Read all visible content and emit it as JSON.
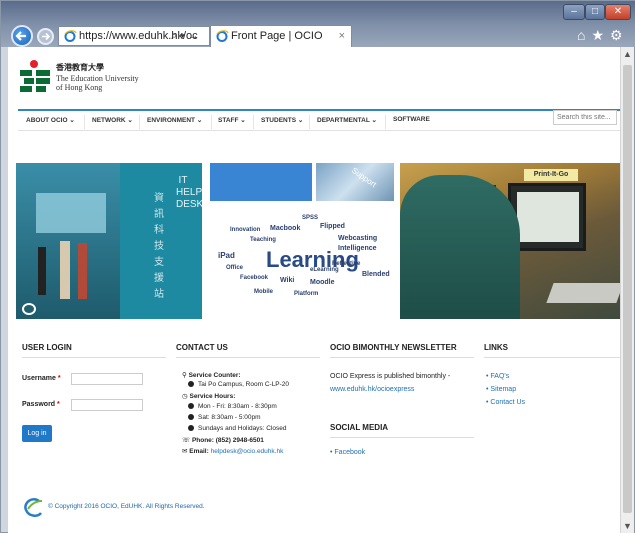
{
  "browser": {
    "address": "https://www.eduhk.hk/oc",
    "address_tools": "⌕ ▾ →",
    "tab_title": "Front Page | OCIO",
    "tab_close": "×",
    "toolbar_icons": "⌂★⚙",
    "win_min": "–",
    "win_max": "□",
    "win_close": "✕"
  },
  "site": {
    "logo_cn": "香港教育大學",
    "logo_en_1": "The Education University",
    "logo_en_2": "of Hong Kong",
    "nav": [
      "ABOUT OCIO ⌄",
      "NETWORK ⌄",
      "ENVIRONMENT ⌄",
      "STAFF ⌄",
      "STUDENTS ⌄",
      "DEPARTMENTAL ⌄",
      "SOFTWARE"
    ],
    "search_placeholder": "Search this site..."
  },
  "banner": {
    "help_desk": "IT HELP DESK",
    "help_desk_cn": "資訊科技支援站",
    "support": "Support",
    "cloud_words": [
      "Learning",
      "Webcasting",
      "Intelligence",
      "Reflective",
      "Blended",
      "Flipped",
      "SPSS",
      "Macbook",
      "iPad",
      "Facebook",
      "Wiki",
      "Moodle",
      "Teaching",
      "Innovation",
      "Mobile",
      "Platform",
      "eLearning",
      "Office"
    ],
    "lab_sign": "Print-It-Go"
  },
  "login": {
    "heading": "USER LOGIN",
    "username_label": "Username",
    "password_label": "Password",
    "required_mark": "*",
    "button": "Log in"
  },
  "contact": {
    "heading": "CONTACT US",
    "counter_label": "Service Counter:",
    "counter_value": "Tai Po Campus, Room C-LP-20",
    "hours_label": "Service Hours:",
    "hours": [
      "Mon - Fri: 8:30am - 8:30pm",
      "Sat: 8:30am - 5:00pm",
      "Sundays and Holidays: Closed"
    ],
    "phone": "Phone: (852) 2948-6501",
    "email_label": "Email:",
    "email": "helpdesk@ocio.eduhk.hk"
  },
  "newsletter": {
    "heading": "OCIO BIMONTHLY NEWSLETTER",
    "text": "OCIO Express is published bimonthly -",
    "link": "www.eduhk.hk/ocioexpress",
    "social_heading": "SOCIAL MEDIA",
    "social_links": [
      "Facebook"
    ]
  },
  "links": {
    "heading": "LINKS",
    "items": [
      "FAQ's",
      "Sitemap",
      "Contact Us"
    ]
  },
  "footer": {
    "copyright": "© Copyright 2016 OCIO, EdUHK. All Rights Reserved."
  }
}
